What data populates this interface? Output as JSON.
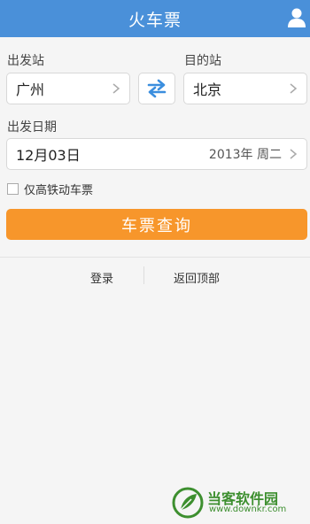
{
  "header": {
    "title": "火车票"
  },
  "from": {
    "label": "出发站",
    "value": "广州"
  },
  "to": {
    "label": "目的站",
    "value": "北京"
  },
  "date": {
    "label": "出发日期",
    "value": "12月03日",
    "detail": "2013年 周二"
  },
  "filter": {
    "label": "仅高铁动车票",
    "checked": false
  },
  "search_button": {
    "label": "车票查询"
  },
  "footer": {
    "login": "登录",
    "back_to_top": "返回顶部"
  },
  "watermark": {
    "title": "当客软件园",
    "url": "www.downkr.com"
  },
  "colors": {
    "header": "#4a90d9",
    "button": "#f7962b",
    "watermark": "#3d8f2f"
  }
}
